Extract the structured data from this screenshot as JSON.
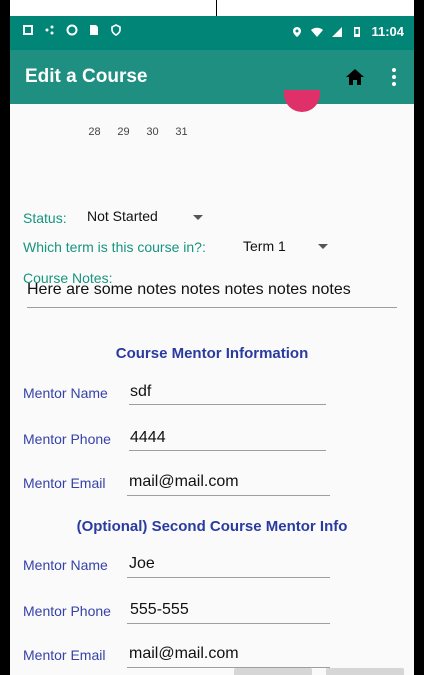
{
  "status_bar": {
    "time": "11:04",
    "left_icons": [
      "notification-icon",
      "network-icon",
      "circle-icon",
      "sim-icon",
      "shield-icon"
    ],
    "right_icons": [
      "location-icon",
      "wifi-icon",
      "signal-icon",
      "battery-icon"
    ]
  },
  "app_bar": {
    "title": "Edit a Course",
    "home_icon": "home-icon",
    "menu_icon": "overflow-menu-icon",
    "color": "#1f8f82"
  },
  "calendar": {
    "days": [
      "28",
      "29",
      "30",
      "31"
    ]
  },
  "status": {
    "label": "Status:",
    "value": "Not Started"
  },
  "term": {
    "label": "Which term is this course in?:",
    "value": "Term 1"
  },
  "notes": {
    "label": "Course Notes:",
    "value": "Here are some notes notes notes notes notes"
  },
  "mentor1": {
    "title": "Course Mentor Information",
    "name_label": "Mentor Name",
    "name_value": "sdf",
    "phone_label": "Mentor Phone",
    "phone_value": "4444",
    "email_label": "Mentor Email",
    "email_value": "mail@mail.com"
  },
  "mentor2": {
    "title": "(Optional) Second Course Mentor Info",
    "name_label": "Mentor Name",
    "name_value": "Joe",
    "phone_label": "Mentor Phone",
    "phone_value": "555-555",
    "email_label": "Mentor Email",
    "email_value": "mail@mail.com"
  },
  "colors": {
    "teal_label": "#17957f",
    "blue_label": "#3642a8",
    "status_bar": "#008577"
  }
}
